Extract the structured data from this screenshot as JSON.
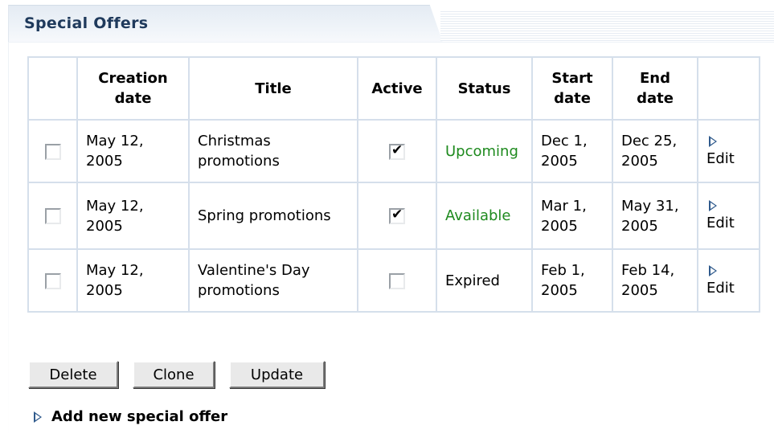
{
  "header": {
    "title": "Special Offers"
  },
  "table": {
    "columns": [
      "",
      "Creation date",
      "Title",
      "Active",
      "Status",
      "Start date",
      "End date",
      ""
    ],
    "rows": [
      {
        "selected": false,
        "creation_date": "May 12, 2005",
        "title": "Christmas promotions",
        "active": true,
        "status": "Upcoming",
        "start_date": "Dec 1, 2005",
        "end_date": "Dec 25, 2005",
        "edit_label": "Edit"
      },
      {
        "selected": false,
        "creation_date": "May 12, 2005",
        "title": "Spring promotions",
        "active": true,
        "status": "Available",
        "start_date": "Mar 1, 2005",
        "end_date": "May 31, 2005",
        "edit_label": "Edit"
      },
      {
        "selected": false,
        "creation_date": "May 12, 2005",
        "title": "Valentine's Day promotions",
        "active": false,
        "status": "Expired",
        "start_date": "Feb 1, 2005",
        "end_date": "Feb 14, 2005",
        "edit_label": "Edit"
      }
    ],
    "icons": {
      "row_select": "checkbox-icon",
      "active": "checkbox-icon",
      "edit": "play-arrow-icon"
    }
  },
  "actions": {
    "delete_label": "Delete",
    "clone_label": "Clone",
    "update_label": "Update"
  },
  "add_link": {
    "label": "Add new special offer",
    "icon": "play-arrow-icon"
  },
  "colors": {
    "title_text": "#1f3a5c",
    "table_border": "#d5dfeb",
    "status_green": "#1e8a1e",
    "icon_blue": "#2f5a8c",
    "button_face": "#e9e9e9"
  }
}
